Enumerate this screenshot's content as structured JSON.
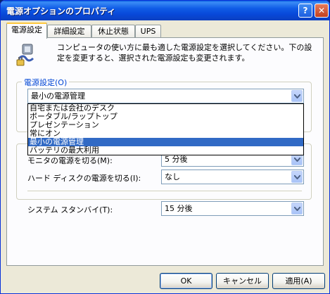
{
  "window": {
    "title": "電源オプションのプロパティ",
    "help_glyph": "?",
    "close_glyph": "✕"
  },
  "tabs": [
    {
      "label": "電源設定",
      "active": true
    },
    {
      "label": "詳細設定",
      "active": false
    },
    {
      "label": "休止状態",
      "active": false
    },
    {
      "label": "UPS",
      "active": false
    }
  ],
  "description": "コンピュータの使い方に最も適した電源設定を選択してください。下の設定を変更すると、選択された電源設定も変更されます。",
  "scheme_group": {
    "label": "電源設定(O)",
    "selected": "最小の電源管理",
    "options": [
      "自宅または会社のデスク",
      "ポータブル/ラップトップ",
      "プレゼンテーション",
      "常にオン",
      "最小の電源管理",
      "バッテリの最大利用"
    ],
    "selected_index": 4
  },
  "settings": {
    "monitor": {
      "label": "モニタの電源を切る(M):",
      "value": "5 分後"
    },
    "harddisk": {
      "label": "ハード ディスクの電源を切る(I):",
      "value": "なし"
    },
    "standby": {
      "label": "システム スタンバイ(T):",
      "value": "15 分後"
    }
  },
  "buttons": {
    "ok": "OK",
    "cancel": "キャンセル",
    "apply": "適用(A)"
  },
  "colors": {
    "titlebar": "#0848d8",
    "selection": "#316ac5",
    "group_label": "#0046d5"
  }
}
